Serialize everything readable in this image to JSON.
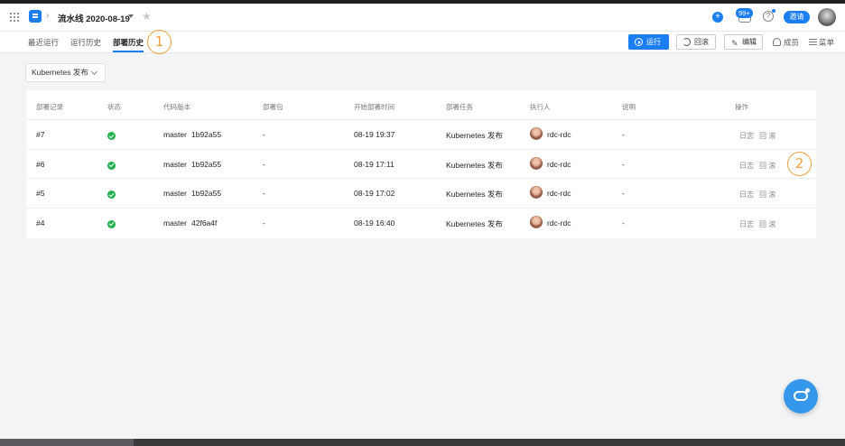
{
  "header": {
    "page_title": "流水线 2020-08-19",
    "notification_count": "99+",
    "help_label": "?",
    "invite_label": "邀请",
    "plus_label": "+"
  },
  "tabs": [
    {
      "label": "最近运行"
    },
    {
      "label": "运行历史"
    },
    {
      "label": "部署历史"
    }
  ],
  "toolbar": {
    "run_label": "运行",
    "rollback_label": "回滚",
    "edit_label": "编辑",
    "members_label": "成员",
    "menu_label": "菜单"
  },
  "annotations": {
    "first": "1",
    "second": "2"
  },
  "filter": {
    "selected": "Kubernetes 发布"
  },
  "table": {
    "headers": [
      "部署记录",
      "状态",
      "代码版本",
      "部署包",
      "开始部署时间",
      "部署任务",
      "执行人",
      "说明",
      "操作"
    ],
    "rows": [
      {
        "record": "#7",
        "branch": "master",
        "commit": "1b92a55",
        "package": "-",
        "start_time": "08-19 19:37",
        "task": "Kubernetes 发布",
        "executor": "rdc-rdc",
        "note": "-",
        "log": "日志",
        "rollback": "回 滚"
      },
      {
        "record": "#6",
        "branch": "master",
        "commit": "1b92a55",
        "package": "-",
        "start_time": "08-19 17:11",
        "task": "Kubernetes 发布",
        "executor": "rdc-rdc",
        "note": "-",
        "log": "日志",
        "rollback": "回 滚"
      },
      {
        "record": "#5",
        "branch": "master",
        "commit": "1b92a55",
        "package": "-",
        "start_time": "08-19 17:02",
        "task": "Kubernetes 发布",
        "executor": "rdc-rdc",
        "note": "-",
        "log": "日志",
        "rollback": "回 滚"
      },
      {
        "record": "#4",
        "branch": "master",
        "commit": "42f6a4f",
        "package": "-",
        "start_time": "08-19 16:40",
        "task": "Kubernetes 发布",
        "executor": "rdc-rdc",
        "note": "-",
        "log": "日志",
        "rollback": "回 滚"
      }
    ]
  },
  "colors": {
    "accent": "#1b7ef3",
    "success": "#22b14c",
    "annotation": "#f0a03c"
  }
}
